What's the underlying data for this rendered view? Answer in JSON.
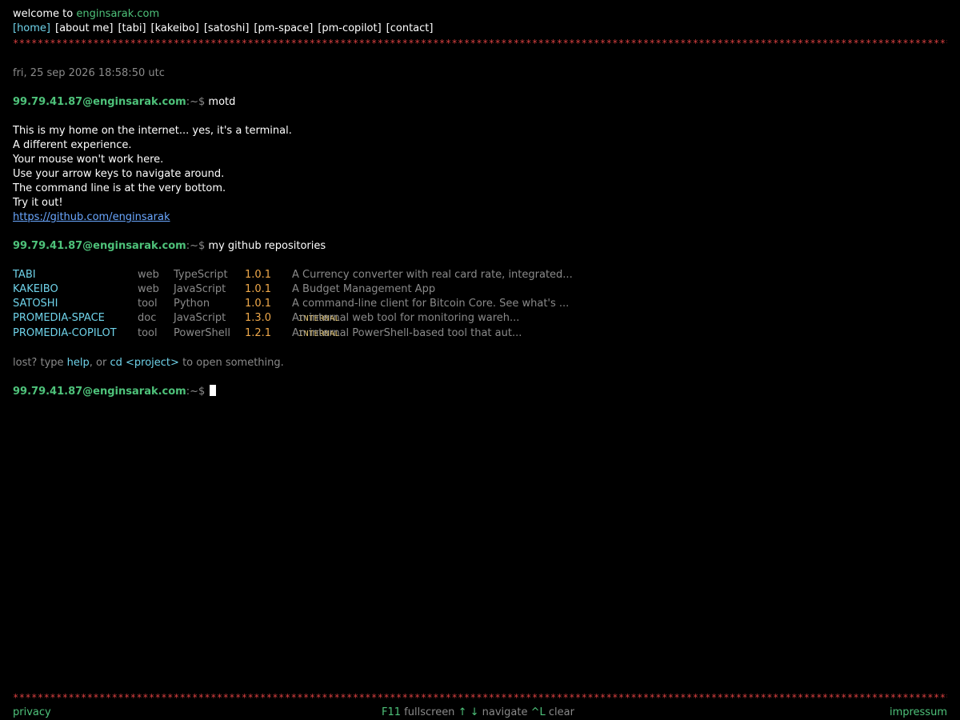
{
  "header": {
    "welcome_prefix": "welcome to",
    "site": "enginsarak.com"
  },
  "nav": [
    "[home]",
    "[about me]",
    "[tabi]",
    "[kakeibo]",
    "[satoshi]",
    "[pm-space]",
    "[pm-copilot]",
    "[contact]"
  ],
  "stars": "**************************************************************************************************************************************************************************************************",
  "timestamp": "fri, 25 sep 2026 18:58:50 utc",
  "prompt": {
    "user_host": "99.79.41.87@enginsarak.com",
    "path": ":~$"
  },
  "cmd1": "motd",
  "motd": [
    "This is my home on the internet... yes, it's a terminal.",
    "A different experience.",
    "Your mouse won't work here.",
    "Use your arrow keys to navigate around.",
    "The command line is at the very bottom.",
    "Try it out!"
  ],
  "github_link": "https://github.com/enginsarak",
  "cmd2": "my github repositories",
  "repos": [
    {
      "name": "TABI",
      "type": "web",
      "lang": "TypeScript",
      "version": "1.0.1",
      "desc": "A Currency converter with real card rate, integrated...",
      "tag": ""
    },
    {
      "name": "KAKEIBO",
      "type": "web",
      "lang": "JavaScript",
      "version": "1.0.1",
      "desc": "A Budget Management App",
      "tag": ""
    },
    {
      "name": "SATOSHI",
      "type": "tool",
      "lang": "Python",
      "version": "1.0.1",
      "desc": "A command-line client for Bitcoin Core. See what's ...",
      "tag": ""
    },
    {
      "name": "PROMEDIA-SPACE",
      "type": "doc",
      "lang": "JavaScript",
      "version": "1.3.0",
      "desc": "An internal web tool for monitoring wareh...",
      "tag": "INTERNAL"
    },
    {
      "name": "PROMEDIA-COPILOT",
      "type": "tool",
      "lang": "PowerShell",
      "version": "1.2.1",
      "desc": "An internal PowerShell-based tool that aut...",
      "tag": "INTERNAL"
    }
  ],
  "hint": {
    "lost": "lost? type",
    "help": "help",
    "or": ", or",
    "cd": "cd <project>",
    "rest": "to open something."
  },
  "footer": {
    "privacy": "privacy",
    "f11": "F11",
    "fullscreen": "fullscreen",
    "arrows": "↑ ↓",
    "navigate": "navigate",
    "ctrl_l": "^L",
    "clear": "clear",
    "impressum": "impressum"
  },
  "colors": {
    "background": "#000000",
    "green": "#4ec27a",
    "cyan": "#6fd3ea",
    "orange": "#f0a94a",
    "grey": "#8a8a8a",
    "red": "#d94040",
    "link": "#6aa7ff"
  }
}
